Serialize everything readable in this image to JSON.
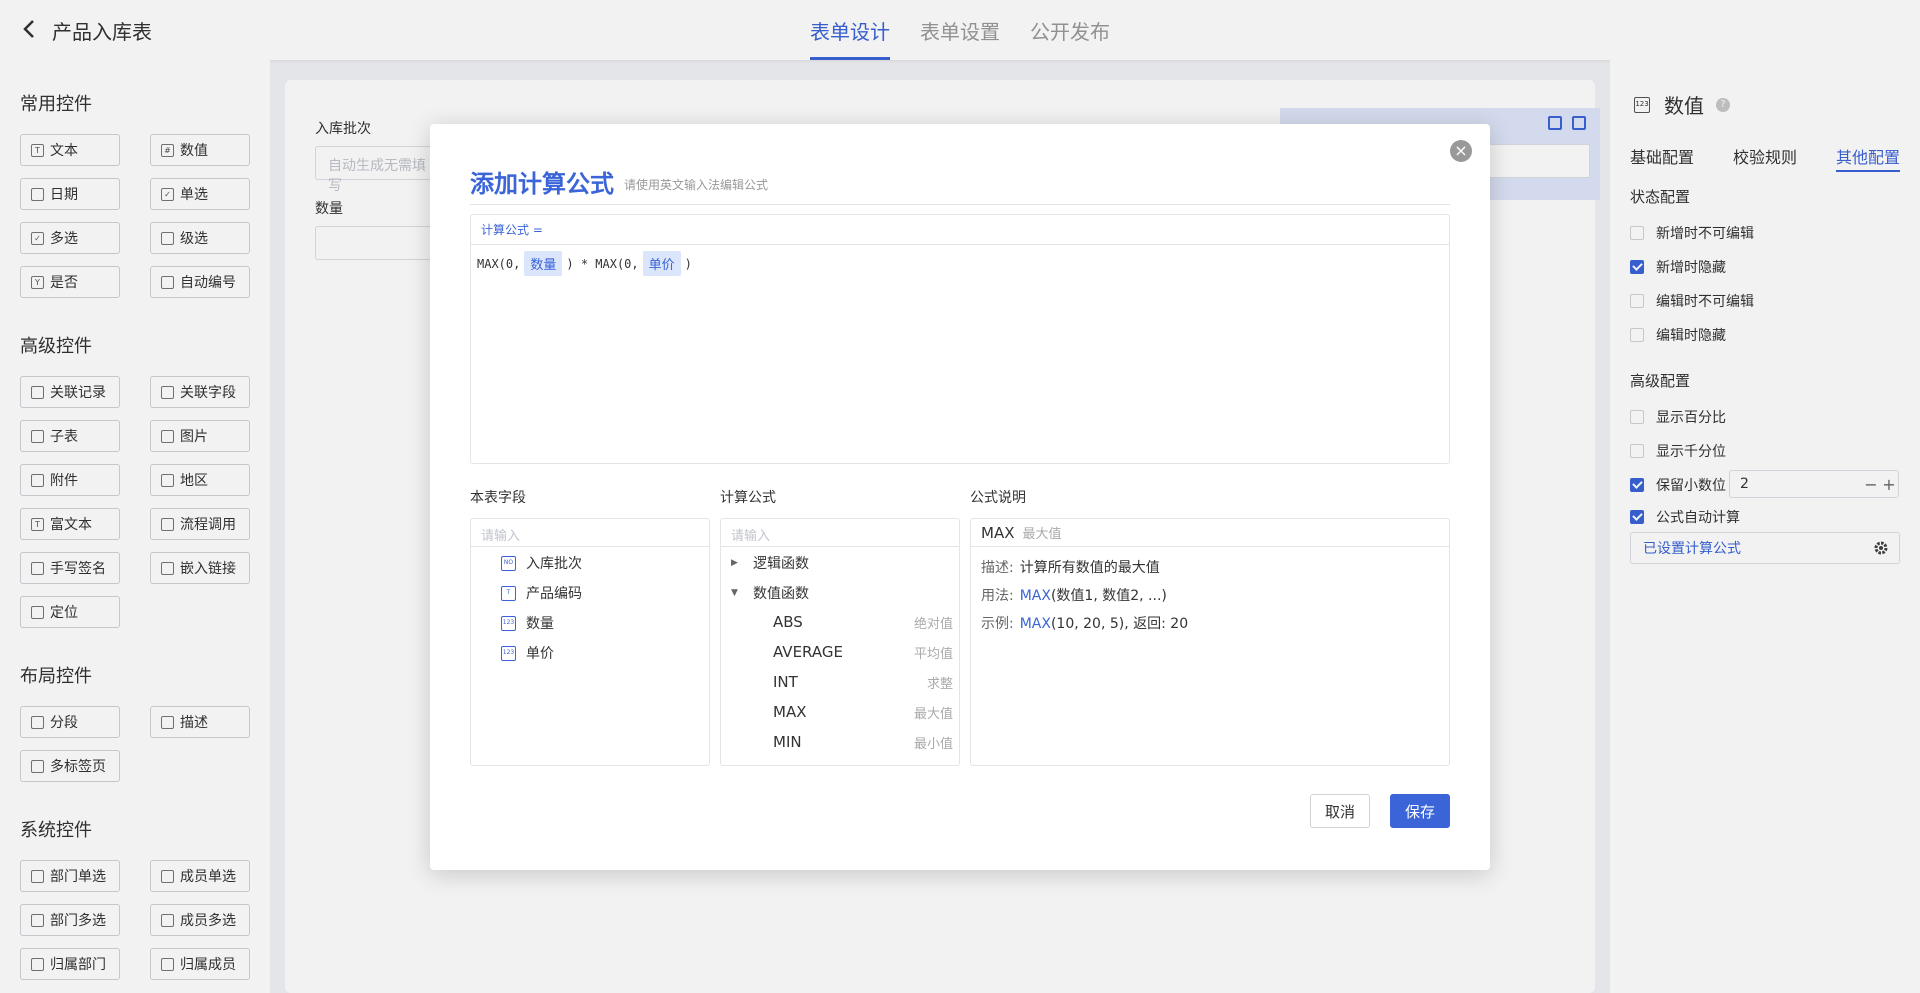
{
  "header": {
    "title": "产品入库表",
    "tabs": [
      "表单设计",
      "表单设置",
      "公开发布"
    ]
  },
  "sidebar": {
    "sections": {
      "common": {
        "title": "常用控件",
        "items": [
          "文本",
          "数值",
          "日期",
          "单选",
          "多选",
          "级选",
          "是否",
          "自动编号"
        ]
      },
      "advanced": {
        "title": "高级控件",
        "items": [
          "关联记录",
          "关联字段",
          "子表",
          "图片",
          "附件",
          "地区",
          "富文本",
          "流程调用",
          "手写签名",
          "嵌入链接",
          "定位"
        ]
      },
      "layout": {
        "title": "布局控件",
        "items": [
          "分段",
          "描述",
          "多标签页"
        ]
      },
      "system": {
        "title": "系统控件",
        "items": [
          "部门单选",
          "成员单选",
          "部门多选",
          "成员多选",
          "归属部门",
          "归属成员"
        ]
      }
    }
  },
  "canvas": {
    "fields": [
      {
        "label": "入库批次",
        "placeholder": "自动生成无需填写"
      },
      {
        "label": "数量",
        "placeholder": ""
      }
    ]
  },
  "right_panel": {
    "title": "数值",
    "tabs": [
      "基础配置",
      "校验规则",
      "其他配置"
    ],
    "state_config": {
      "title": "状态配置",
      "options": [
        {
          "label": "新增时不可编辑",
          "checked": false
        },
        {
          "label": "新增时隐藏",
          "checked": true
        },
        {
          "label": "编辑时不可编辑",
          "checked": false
        },
        {
          "label": "编辑时隐藏",
          "checked": false
        }
      ]
    },
    "advanced_config": {
      "title": "高级配置",
      "options": [
        {
          "label": "显示百分比",
          "checked": false
        },
        {
          "label": "显示千分位",
          "checked": false
        },
        {
          "label": "保留小数位",
          "checked": true
        },
        {
          "label": "公式自动计算",
          "checked": true
        }
      ],
      "decimal_places": "2",
      "formula_status": "已设置计算公式"
    }
  },
  "modal": {
    "title": "添加计算公式",
    "hint": "请使用英文输入法编辑公式",
    "editor_header": "计算公式 =",
    "expression": {
      "part1": "MAX(0,",
      "chip1": "数量",
      "part2": ") * MAX(0,",
      "chip2": "单价",
      "part3": ")"
    },
    "columns": {
      "fields": {
        "label": "本表字段",
        "placeholder": "请输入",
        "items": [
          "入库批次",
          "产品编码",
          "数量",
          "单价"
        ]
      },
      "functions": {
        "label": "计算公式",
        "placeholder": "请输入",
        "categories": [
          "逻辑函数",
          "数值函数"
        ],
        "items": [
          {
            "name": "ABS",
            "desc": "绝对值"
          },
          {
            "name": "AVERAGE",
            "desc": "平均值"
          },
          {
            "name": "INT",
            "desc": "求整"
          },
          {
            "name": "MAX",
            "desc": "最大值"
          },
          {
            "name": "MIN",
            "desc": "最小值"
          }
        ]
      },
      "description": {
        "label": "公式说明",
        "func_name": "MAX",
        "func_desc": "最大值",
        "desc_key": "描述:",
        "desc_val": "计算所有数值的最大值",
        "usage_key": "用法:",
        "usage_fn": "MAX",
        "usage_args": "(数值1, 数值2, ...)",
        "example_key": "示例:",
        "example_fn": "MAX",
        "example_args": "(10, 20, 5), 返回: 20"
      }
    },
    "buttons": {
      "cancel": "取消",
      "save": "保存"
    }
  },
  "colors": {
    "accent": "#3a64d8"
  }
}
